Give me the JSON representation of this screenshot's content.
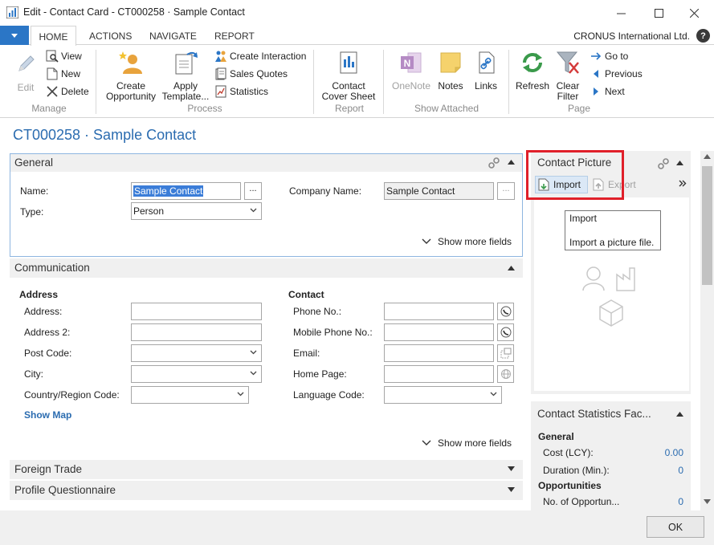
{
  "window": {
    "title": "Edit - Contact Card - CT000258 · Sample Contact"
  },
  "ribbon": {
    "tabs": [
      "HOME",
      "ACTIONS",
      "NAVIGATE",
      "REPORT"
    ],
    "company": "CRONUS International Ltd.",
    "help": "?",
    "groups": {
      "manage": {
        "label": "Manage",
        "edit": "Edit",
        "view": "View",
        "new": "New",
        "delete": "Delete"
      },
      "process": {
        "label": "Process",
        "create_opportunity_1": "Create",
        "create_opportunity_2": "Opportunity",
        "apply_template_1": "Apply",
        "apply_template_2": "Template...",
        "create_interaction": "Create Interaction",
        "sales_quotes": "Sales Quotes",
        "statistics": "Statistics"
      },
      "report": {
        "label": "Report",
        "cover_1": "Contact",
        "cover_2": "Cover Sheet"
      },
      "show_attached": {
        "label": "Show Attached",
        "onenote": "OneNote",
        "notes": "Notes",
        "links": "Links"
      },
      "page": {
        "label": "Page",
        "refresh": "Refresh",
        "clear_1": "Clear",
        "clear_2": "Filter",
        "goto": "Go to",
        "previous": "Previous",
        "next": "Next"
      }
    }
  },
  "page_title": "CT000258 · Sample Contact",
  "general": {
    "title": "General",
    "name_label": "Name:",
    "name_value": "Sample Contact",
    "type_label": "Type:",
    "type_value": "Person",
    "company_label": "Company Name:",
    "company_value": "Sample Contact",
    "lookup": "...",
    "show_more": "Show more fields"
  },
  "communication": {
    "title": "Communication",
    "address_header": "Address",
    "address_label": "Address:",
    "address2_label": "Address 2:",
    "post_code_label": "Post Code:",
    "city_label": "City:",
    "country_label": "Country/Region Code:",
    "show_map": "Show Map",
    "contact_header": "Contact",
    "phone_label": "Phone No.:",
    "mobile_label": "Mobile Phone No.:",
    "email_label": "Email:",
    "homepage_label": "Home Page:",
    "language_label": "Language Code:",
    "show_more": "Show more fields"
  },
  "foreign_trade": {
    "title": "Foreign Trade"
  },
  "profile": {
    "title": "Profile Questionnaire"
  },
  "contact_picture": {
    "title": "Contact Picture",
    "import": "Import",
    "export": "Export",
    "tooltip_title": "Import",
    "tooltip_desc": "Import a picture file."
  },
  "statistics_factbox": {
    "title": "Contact Statistics Fac...",
    "general_header": "General",
    "cost_label": "Cost (LCY):",
    "cost_value": "0.00",
    "duration_label": "Duration (Min.):",
    "duration_value": "0",
    "opportunities_header": "Opportunities",
    "no_opps_label": "No. of Opportun...",
    "no_opps_value": "0"
  },
  "ok_button": "OK",
  "colors": {
    "accent": "#2b6cb0",
    "highlight_box": "#e0202a",
    "file_tab": "#2b76c6"
  }
}
